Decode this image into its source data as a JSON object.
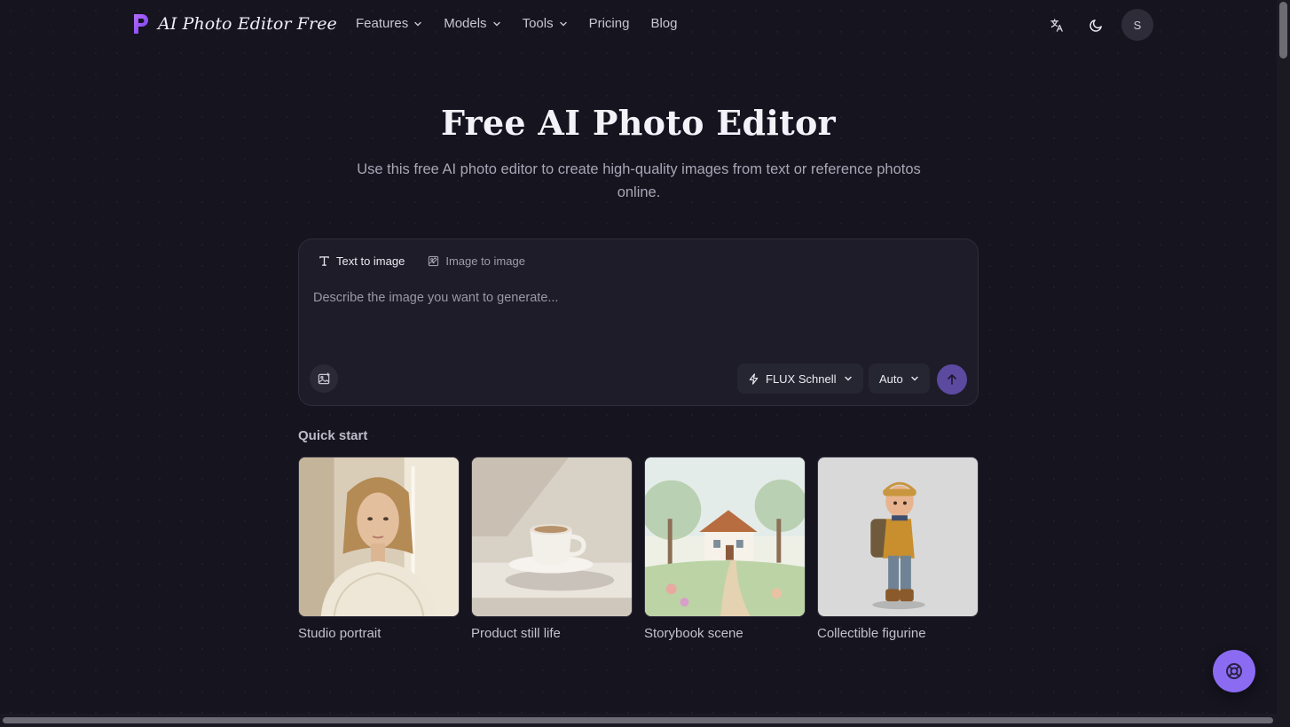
{
  "brand": {
    "name": "AI Photo Editor Free",
    "logo_icon": "p-logo-icon"
  },
  "nav": [
    {
      "label": "Features",
      "has_dropdown": true
    },
    {
      "label": "Models",
      "has_dropdown": true
    },
    {
      "label": "Tools",
      "has_dropdown": true
    },
    {
      "label": "Pricing",
      "has_dropdown": false
    },
    {
      "label": "Blog",
      "has_dropdown": false
    }
  ],
  "header_actions": {
    "language_icon": "translate-icon",
    "theme_icon": "moon-icon",
    "avatar_initial": "S"
  },
  "hero": {
    "title": "Free AI Photo Editor",
    "subtitle": "Use this free AI photo editor to create high-quality images from text or reference photos online."
  },
  "composer": {
    "tabs": [
      {
        "label": "Text to image",
        "active": true,
        "icon": "text-icon"
      },
      {
        "label": "Image to image",
        "active": false,
        "icon": "image-edit-icon"
      }
    ],
    "placeholder": "Describe the image you want to generate...",
    "value": "",
    "model": "FLUX Schnell",
    "aspect_ratio": "Auto"
  },
  "quick_start": {
    "title": "Quick start",
    "items": [
      {
        "label": "Studio portrait"
      },
      {
        "label": "Product still life"
      },
      {
        "label": "Storybook scene"
      },
      {
        "label": "Collectible figurine"
      }
    ]
  },
  "colors": {
    "background": "#15141f",
    "accent": "#8b6bf2",
    "send_button": "#5b4aa0",
    "panel": "#1d1c28"
  }
}
